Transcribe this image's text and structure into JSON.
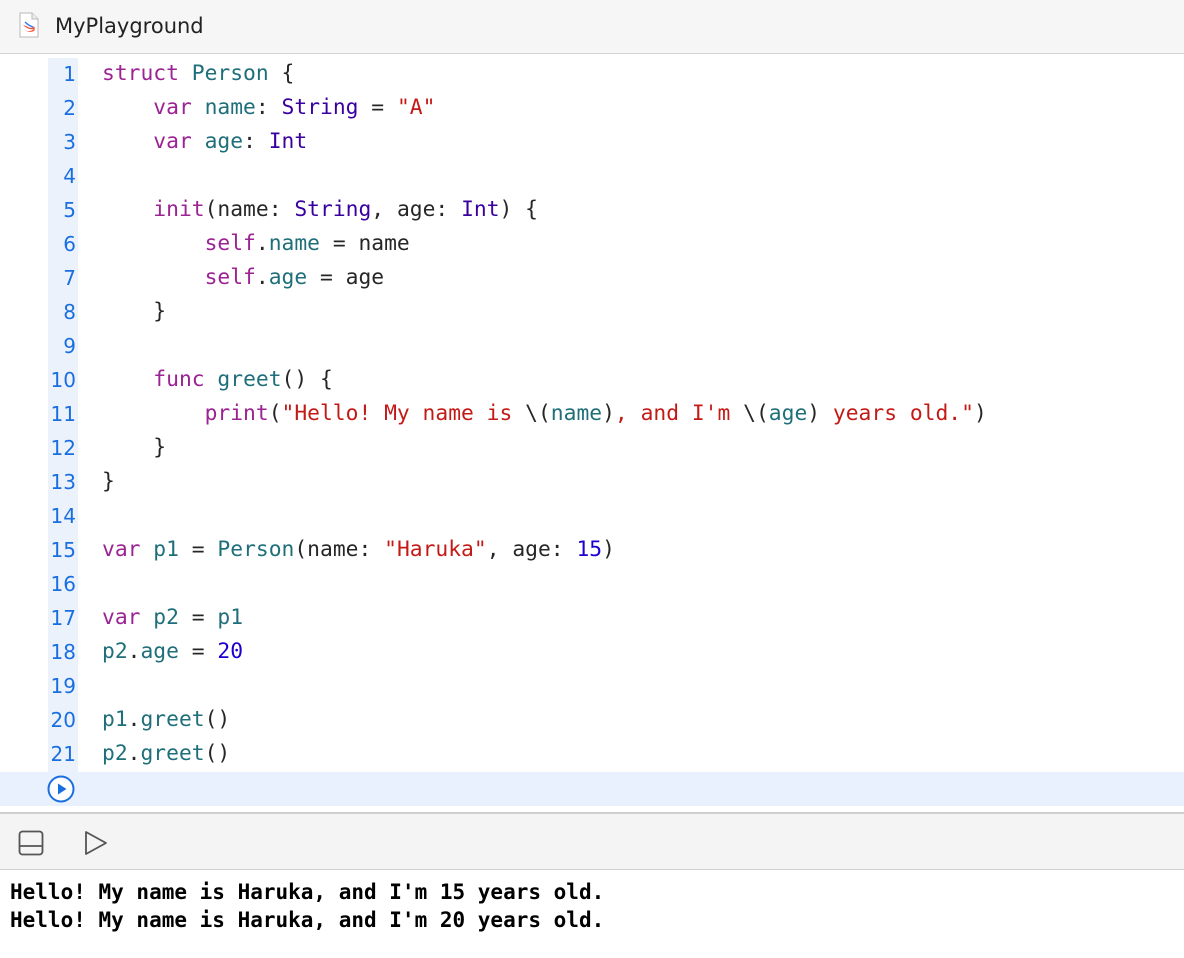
{
  "window": {
    "title": "MyPlayground",
    "icon": "swift-file-icon"
  },
  "colors": {
    "keyword": "#9b2393",
    "type": "#3900a0",
    "identifier": "#1f6f7a",
    "string": "#c41a16",
    "number": "#1c00cf",
    "line_number": "#1a6fe0",
    "gutter_highlight": "#ecf2fb",
    "current_line": "#e8f1fd"
  },
  "editor": {
    "lines": [
      {
        "n": "1",
        "tokens": [
          [
            "kw",
            "struct"
          ],
          [
            "pl",
            " "
          ],
          [
            "id",
            "Person"
          ],
          [
            "pl",
            " {"
          ]
        ]
      },
      {
        "n": "2",
        "tokens": [
          [
            "pl",
            "    "
          ],
          [
            "kw",
            "var"
          ],
          [
            "pl",
            " "
          ],
          [
            "id",
            "name"
          ],
          [
            "pl",
            ": "
          ],
          [
            "ty",
            "String"
          ],
          [
            "pl",
            " = "
          ],
          [
            "st",
            "\"A\""
          ]
        ]
      },
      {
        "n": "3",
        "tokens": [
          [
            "pl",
            "    "
          ],
          [
            "kw",
            "var"
          ],
          [
            "pl",
            " "
          ],
          [
            "id",
            "age"
          ],
          [
            "pl",
            ": "
          ],
          [
            "ty",
            "Int"
          ]
        ]
      },
      {
        "n": "4",
        "tokens": []
      },
      {
        "n": "5",
        "tokens": [
          [
            "pl",
            "    "
          ],
          [
            "kw",
            "init"
          ],
          [
            "pl",
            "(name: "
          ],
          [
            "ty",
            "String"
          ],
          [
            "pl",
            ", age: "
          ],
          [
            "ty",
            "Int"
          ],
          [
            "pl",
            ") {"
          ]
        ]
      },
      {
        "n": "6",
        "tokens": [
          [
            "pl",
            "        "
          ],
          [
            "kw",
            "self"
          ],
          [
            "pl",
            "."
          ],
          [
            "id",
            "name"
          ],
          [
            "pl",
            " = name"
          ]
        ]
      },
      {
        "n": "7",
        "tokens": [
          [
            "pl",
            "        "
          ],
          [
            "kw",
            "self"
          ],
          [
            "pl",
            "."
          ],
          [
            "id",
            "age"
          ],
          [
            "pl",
            " = age"
          ]
        ]
      },
      {
        "n": "8",
        "tokens": [
          [
            "pl",
            "    }"
          ]
        ]
      },
      {
        "n": "9",
        "tokens": []
      },
      {
        "n": "10",
        "tokens": [
          [
            "pl",
            "    "
          ],
          [
            "kw",
            "func"
          ],
          [
            "pl",
            " "
          ],
          [
            "id",
            "greet"
          ],
          [
            "pl",
            "() {"
          ]
        ]
      },
      {
        "n": "11",
        "tokens": [
          [
            "pl",
            "        "
          ],
          [
            "kw",
            "print"
          ],
          [
            "pl",
            "("
          ],
          [
            "st",
            "\"Hello! My name is "
          ],
          [
            "pl",
            "\\("
          ],
          [
            "id",
            "name"
          ],
          [
            "pl",
            ")"
          ],
          [
            "st",
            ", and I'm "
          ],
          [
            "pl",
            "\\("
          ],
          [
            "id",
            "age"
          ],
          [
            "pl",
            ")"
          ],
          [
            "st",
            " years old.\""
          ],
          [
            "pl",
            ")"
          ]
        ]
      },
      {
        "n": "12",
        "tokens": [
          [
            "pl",
            "    }"
          ]
        ]
      },
      {
        "n": "13",
        "tokens": [
          [
            "pl",
            "}"
          ]
        ]
      },
      {
        "n": "14",
        "tokens": []
      },
      {
        "n": "15",
        "tokens": [
          [
            "kw",
            "var"
          ],
          [
            "pl",
            " "
          ],
          [
            "id",
            "p1"
          ],
          [
            "pl",
            " = "
          ],
          [
            "id",
            "Person"
          ],
          [
            "pl",
            "(name: "
          ],
          [
            "st",
            "\"Haruka\""
          ],
          [
            "pl",
            ", age: "
          ],
          [
            "nu",
            "15"
          ],
          [
            "pl",
            ")"
          ]
        ]
      },
      {
        "n": "16",
        "tokens": []
      },
      {
        "n": "17",
        "tokens": [
          [
            "kw",
            "var"
          ],
          [
            "pl",
            " "
          ],
          [
            "id",
            "p2"
          ],
          [
            "pl",
            " = "
          ],
          [
            "id",
            "p1"
          ]
        ]
      },
      {
        "n": "18",
        "tokens": [
          [
            "id",
            "p2"
          ],
          [
            "pl",
            "."
          ],
          [
            "id",
            "age"
          ],
          [
            "pl",
            " = "
          ],
          [
            "nu",
            "20"
          ]
        ]
      },
      {
        "n": "19",
        "tokens": []
      },
      {
        "n": "20",
        "tokens": [
          [
            "id",
            "p1"
          ],
          [
            "pl",
            "."
          ],
          [
            "id",
            "greet"
          ],
          [
            "pl",
            "()"
          ]
        ]
      },
      {
        "n": "21",
        "tokens": [
          [
            "id",
            "p2"
          ],
          [
            "pl",
            "."
          ],
          [
            "id",
            "greet"
          ],
          [
            "pl",
            "()"
          ]
        ]
      }
    ],
    "run_button_icon": "play-circle-icon"
  },
  "debug_bar": {
    "toggle_icon": "debug-area-toggle-icon",
    "run_icon": "play-icon"
  },
  "console": {
    "output": [
      "Hello! My name is Haruka, and I'm 15 years old.",
      "Hello! My name is Haruka, and I'm 20 years old."
    ]
  }
}
